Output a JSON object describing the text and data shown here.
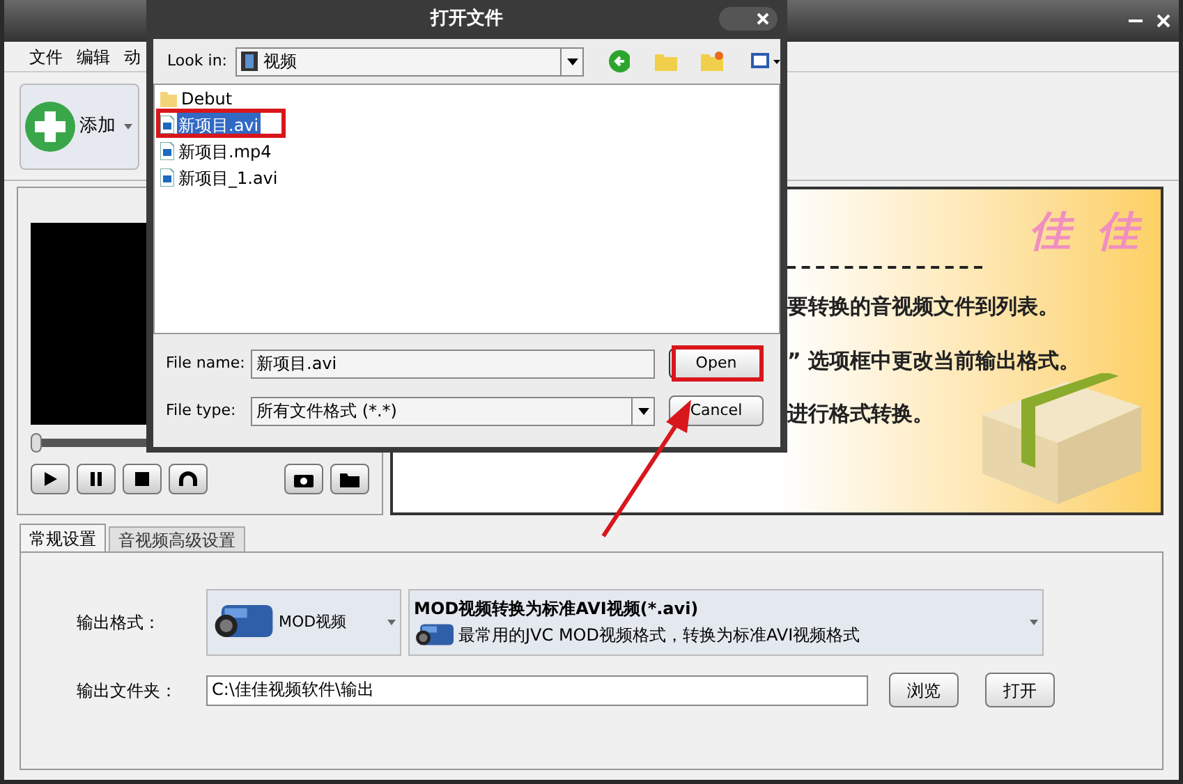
{
  "main_window": {
    "menu": [
      {
        "label": "文件"
      },
      {
        "label": "编辑"
      },
      {
        "label": "动"
      }
    ],
    "add_button": "添加",
    "player": {
      "level": 0
    },
    "banner": {
      "logo": "佳 佳",
      "lines": [
        "要转换的音视频文件到列表。",
        "” 选项框中更改当前输出格式。",
        "进行格式转换。"
      ]
    },
    "tabs": [
      {
        "label": "常规设置",
        "selected": true
      },
      {
        "label": "音视频高级设置",
        "selected": false
      }
    ],
    "output_format": {
      "label": "输出格式：",
      "profile": "MOD视频",
      "title": "MOD视频转换为标准AVI视频(*.avi)",
      "description": "最常用的JVC MOD视频格式，转换为标准AVI视频格式"
    },
    "output_folder": {
      "label": "输出文件夹：",
      "path": "C:\\佳佳视频软件\\输出",
      "buttons": [
        "浏览",
        "打开"
      ]
    }
  },
  "dialog": {
    "title": "打开文件",
    "look_in": {
      "label": "Look in:",
      "value": "视频"
    },
    "files": [
      {
        "name": "Debut",
        "kind": "folder",
        "selected": false
      },
      {
        "name": "新项目.avi",
        "kind": "video",
        "selected": true
      },
      {
        "name": "新项目.mp4",
        "kind": "video",
        "selected": false
      },
      {
        "name": "新项目_1.avi",
        "kind": "video",
        "selected": false
      }
    ],
    "file_name": {
      "label": "File name:",
      "value": "新项目.avi"
    },
    "file_type": {
      "label": "File type:",
      "value": "所有文件格式 (*.*)"
    },
    "buttons": [
      {
        "label": "Open",
        "kind": "default"
      },
      {
        "label": "Cancel",
        "kind": "normal"
      }
    ]
  }
}
